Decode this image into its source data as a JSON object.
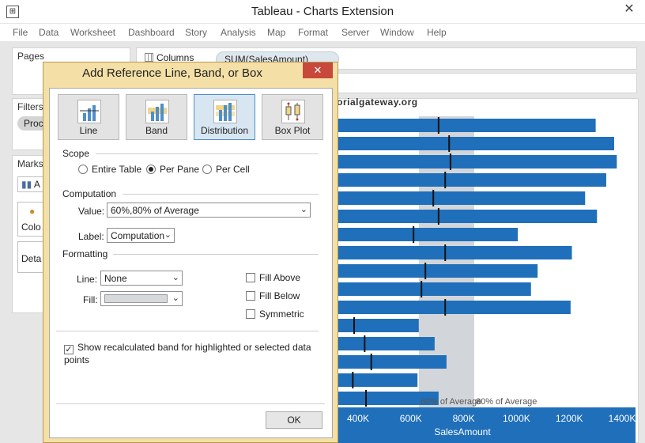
{
  "window": {
    "title": "Tableau - Charts Extension",
    "close": "✕"
  },
  "menu": [
    "File",
    "Data",
    "Worksheet",
    "Dashboard",
    "Story",
    "Analysis",
    "Map",
    "Format",
    "Server",
    "Window",
    "Help"
  ],
  "left_panes": {
    "pages": "Pages",
    "filters": "Filters",
    "filter_pill": "Proc",
    "marks": "Marks",
    "marks_type": "A",
    "color": "Colo",
    "detail": "Deta"
  },
  "shelves": {
    "columns_label": "Columns",
    "columns_pill": "SUM(SalesAmount)"
  },
  "watermark": "©tutorialgateway.org",
  "dialog": {
    "title": "Add Reference Line, Band, or Box",
    "close": "✕",
    "types": [
      {
        "label": "Line",
        "selected": false
      },
      {
        "label": "Band",
        "selected": false
      },
      {
        "label": "Distribution",
        "selected": true
      },
      {
        "label": "Box Plot",
        "selected": false
      }
    ],
    "scope": {
      "label": "Scope",
      "options": [
        {
          "label": "Entire Table",
          "checked": false
        },
        {
          "label": "Per Pane",
          "checked": true
        },
        {
          "label": "Per Cell",
          "checked": false
        }
      ]
    },
    "computation": {
      "label": "Computation",
      "value_label": "Value:",
      "value": "60%,80% of Average",
      "label_label": "Label:",
      "label_value": "Computation"
    },
    "formatting": {
      "label": "Formatting",
      "line_label": "Line:",
      "line_value": "None",
      "fill_label": "Fill:",
      "fill_color": "#d7dadd",
      "fill_above": "Fill Above",
      "fill_below": "Fill Below",
      "symmetric": "Symmetric"
    },
    "show_recalculated": {
      "label": "Show recalculated band for highlighted or selected data points",
      "checked": true
    },
    "ok": "OK"
  },
  "chart_data": {
    "type": "bar",
    "orientation": "horizontal",
    "xlabel": "SalesAmount",
    "x_ticks": [
      "400K",
      "600K",
      "800K",
      "1000K",
      "1200K",
      "1400K"
    ],
    "x_tick_values": [
      400000,
      600000,
      800000,
      1000000,
      1200000,
      1400000
    ],
    "xlim": [
      0,
      1450000
    ],
    "series": [
      {
        "values": [
          1300000,
          1370000,
          1380000,
          1340000,
          1260000,
          1305000,
          1005000,
          1210000,
          1080000,
          1055000,
          1205000,
          630000,
          690000,
          735000,
          625000,
          705000
        ],
        "reference_line": [
          705000,
          745000,
          750000,
          730000,
          685000,
          705000,
          610000,
          730000,
          655000,
          640000,
          730000,
          385000,
          425000,
          450000,
          380000,
          430000
        ]
      }
    ],
    "band": {
      "from": 630000,
      "to": 840000,
      "label_60": "60% of Average",
      "label_80": "80% of Average"
    },
    "colors": {
      "bar": "#1f6fba",
      "band": "#d2d6da",
      "axis_bg": "#1f6fba",
      "axis_text": "#ffffff",
      "ref_line": "#111111"
    }
  }
}
